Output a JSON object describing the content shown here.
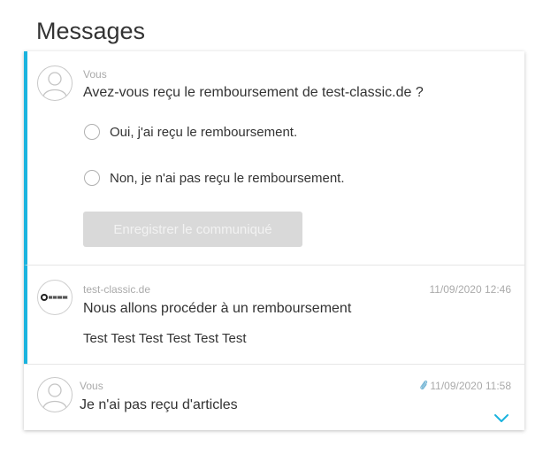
{
  "page_title": "Messages",
  "accent_color": "#1ab3de",
  "messages": [
    {
      "sender": "Vous",
      "avatar": "user-avatar-icon",
      "subject": "Avez-vous reçu le remboursement de test-classic.de ?",
      "options": [
        "Oui, j'ai reçu le remboursement.",
        "Non, je n'ai pas reçu le remboursement."
      ],
      "save_label": "Enregistrer le communiqué"
    },
    {
      "sender": "test-classic.de",
      "avatar": "merchant-logo",
      "date": "11/09/2020 12:46",
      "subject": "Nous allons procéder à un remboursement",
      "body": "Test Test Test Test Test Test"
    },
    {
      "sender": "Vous",
      "avatar": "user-avatar-icon",
      "attachment_icon": "paperclip-icon",
      "date": "11/09/2020 11:58",
      "subject": "Je n'ai pas reçu d'articles",
      "expand_icon": "chevron-down-icon"
    }
  ]
}
